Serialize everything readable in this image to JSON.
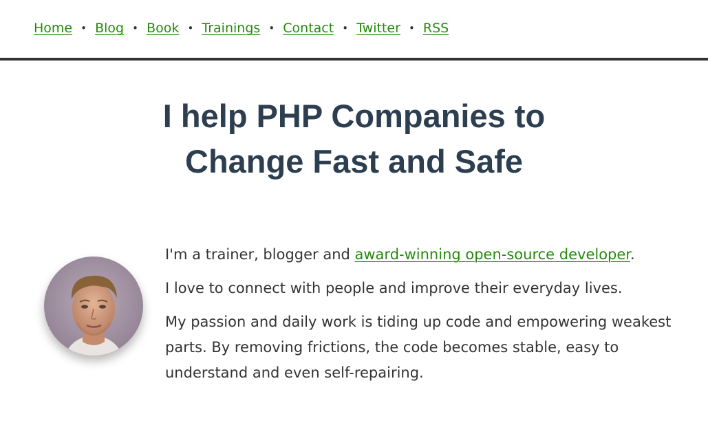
{
  "nav": {
    "items": [
      {
        "label": "Home"
      },
      {
        "label": "Blog"
      },
      {
        "label": "Book"
      },
      {
        "label": "Trainings"
      },
      {
        "label": "Contact"
      },
      {
        "label": "Twitter"
      },
      {
        "label": "RSS"
      }
    ],
    "separator": "•"
  },
  "hero": {
    "title_line1": "I help PHP Companies to",
    "title_line2": "Change Fast and Safe"
  },
  "bio": {
    "p1_prefix": "I'm a trainer, blogger and ",
    "p1_link": "award-winning open-source developer",
    "p1_suffix": ".",
    "p2": "I love to connect with people and improve their everyday lives.",
    "p3": "My passion and daily work is tiding up code and empowering weakest parts. By removing frictions, the code becomes stable, easy to understand and even self-repairing."
  },
  "colors": {
    "link": "#26890d",
    "heading": "#2c3e50",
    "text": "#333333",
    "nav_border": "#333333"
  },
  "avatar": {
    "icon": "profile-photo"
  }
}
